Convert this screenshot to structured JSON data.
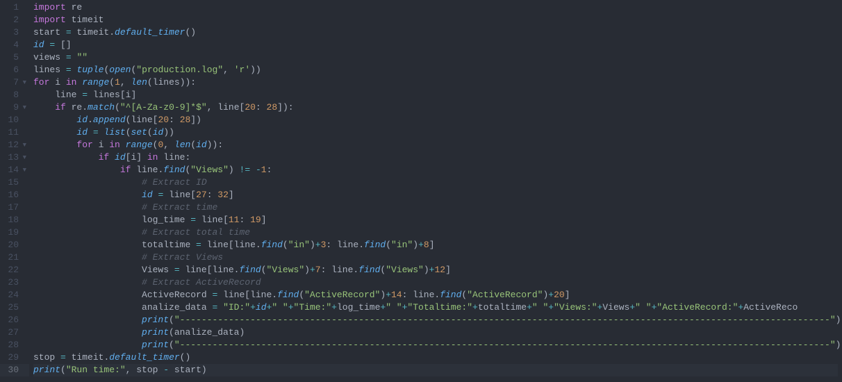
{
  "lines": [
    {
      "num": 1,
      "fold": "",
      "indent": 0,
      "tokens": [
        {
          "t": "import ",
          "c": "kw"
        },
        {
          "t": "re",
          "c": ""
        }
      ]
    },
    {
      "num": 2,
      "fold": "",
      "indent": 0,
      "tokens": [
        {
          "t": "import ",
          "c": "kw"
        },
        {
          "t": "timeit",
          "c": ""
        }
      ]
    },
    {
      "num": 3,
      "fold": "",
      "indent": 0,
      "tokens": [
        {
          "t": "start ",
          "c": ""
        },
        {
          "t": "=",
          "c": "cyan"
        },
        {
          "t": " timeit",
          "c": ""
        },
        {
          "t": ".",
          "c": ""
        },
        {
          "t": "default_timer",
          "c": "italb"
        },
        {
          "t": "()",
          "c": ""
        }
      ]
    },
    {
      "num": 4,
      "fold": "",
      "indent": 0,
      "tokens": [
        {
          "t": "id",
          "c": "italb"
        },
        {
          "t": " ",
          "c": ""
        },
        {
          "t": "=",
          "c": "cyan"
        },
        {
          "t": " []",
          "c": ""
        }
      ]
    },
    {
      "num": 5,
      "fold": "",
      "indent": 0,
      "tokens": [
        {
          "t": "views ",
          "c": ""
        },
        {
          "t": "=",
          "c": "cyan"
        },
        {
          "t": " ",
          "c": ""
        },
        {
          "t": "\"\"",
          "c": "str"
        }
      ]
    },
    {
      "num": 6,
      "fold": "",
      "indent": 0,
      "tokens": [
        {
          "t": "lines ",
          "c": ""
        },
        {
          "t": "=",
          "c": "cyan"
        },
        {
          "t": " ",
          "c": ""
        },
        {
          "t": "tuple",
          "c": "italb"
        },
        {
          "t": "(",
          "c": ""
        },
        {
          "t": "open",
          "c": "italb"
        },
        {
          "t": "(",
          "c": ""
        },
        {
          "t": "\"production.log\"",
          "c": "str"
        },
        {
          "t": ", ",
          "c": ""
        },
        {
          "t": "'r'",
          "c": "str"
        },
        {
          "t": "))",
          "c": ""
        }
      ]
    },
    {
      "num": 7,
      "fold": "▼",
      "indent": 0,
      "tokens": [
        {
          "t": "for ",
          "c": "kw"
        },
        {
          "t": "i ",
          "c": ""
        },
        {
          "t": "in ",
          "c": "kw"
        },
        {
          "t": "range",
          "c": "italb"
        },
        {
          "t": "(",
          "c": ""
        },
        {
          "t": "1",
          "c": "num"
        },
        {
          "t": ", ",
          "c": ""
        },
        {
          "t": "len",
          "c": "italb"
        },
        {
          "t": "(lines)):",
          "c": ""
        }
      ]
    },
    {
      "num": 8,
      "fold": "",
      "indent": 1,
      "tokens": [
        {
          "t": "line ",
          "c": ""
        },
        {
          "t": "=",
          "c": "cyan"
        },
        {
          "t": " lines[i]",
          "c": ""
        }
      ]
    },
    {
      "num": 9,
      "fold": "▼",
      "indent": 1,
      "tokens": [
        {
          "t": "if ",
          "c": "kw"
        },
        {
          "t": "re",
          "c": ""
        },
        {
          "t": ".",
          "c": ""
        },
        {
          "t": "match",
          "c": "italb"
        },
        {
          "t": "(",
          "c": ""
        },
        {
          "t": "\"^[A-Za-z0-9]*$\"",
          "c": "str"
        },
        {
          "t": ", line[",
          "c": ""
        },
        {
          "t": "20",
          "c": "num"
        },
        {
          "t": ": ",
          "c": ""
        },
        {
          "t": "28",
          "c": "num"
        },
        {
          "t": "]):",
          "c": ""
        }
      ]
    },
    {
      "num": 10,
      "fold": "",
      "indent": 2,
      "tokens": [
        {
          "t": "id",
          "c": "italb"
        },
        {
          "t": ".",
          "c": ""
        },
        {
          "t": "append",
          "c": "italb"
        },
        {
          "t": "(line[",
          "c": ""
        },
        {
          "t": "20",
          "c": "num"
        },
        {
          "t": ": ",
          "c": ""
        },
        {
          "t": "28",
          "c": "num"
        },
        {
          "t": "])",
          "c": ""
        }
      ]
    },
    {
      "num": 11,
      "fold": "",
      "indent": 2,
      "tokens": [
        {
          "t": "id",
          "c": "italb"
        },
        {
          "t": " ",
          "c": ""
        },
        {
          "t": "=",
          "c": "cyan"
        },
        {
          "t": " ",
          "c": ""
        },
        {
          "t": "list",
          "c": "italb"
        },
        {
          "t": "(",
          "c": ""
        },
        {
          "t": "set",
          "c": "italb"
        },
        {
          "t": "(",
          "c": ""
        },
        {
          "t": "id",
          "c": "italb"
        },
        {
          "t": "))",
          "c": ""
        }
      ]
    },
    {
      "num": 12,
      "fold": "▼",
      "indent": 2,
      "tokens": [
        {
          "t": "for ",
          "c": "kw"
        },
        {
          "t": "i ",
          "c": ""
        },
        {
          "t": "in ",
          "c": "kw"
        },
        {
          "t": "range",
          "c": "italb"
        },
        {
          "t": "(",
          "c": ""
        },
        {
          "t": "0",
          "c": "num"
        },
        {
          "t": ", ",
          "c": ""
        },
        {
          "t": "len",
          "c": "italb"
        },
        {
          "t": "(",
          "c": ""
        },
        {
          "t": "id",
          "c": "italb"
        },
        {
          "t": ")):",
          "c": ""
        }
      ]
    },
    {
      "num": 13,
      "fold": "▼",
      "indent": 3,
      "tokens": [
        {
          "t": "if ",
          "c": "kw"
        },
        {
          "t": "id",
          "c": "italb"
        },
        {
          "t": "[i] ",
          "c": ""
        },
        {
          "t": "in ",
          "c": "kw"
        },
        {
          "t": "line:",
          "c": ""
        }
      ]
    },
    {
      "num": 14,
      "fold": "▼",
      "indent": 4,
      "tokens": [
        {
          "t": "if ",
          "c": "kw"
        },
        {
          "t": "line",
          "c": ""
        },
        {
          "t": ".",
          "c": ""
        },
        {
          "t": "find",
          "c": "italb"
        },
        {
          "t": "(",
          "c": ""
        },
        {
          "t": "\"Views\"",
          "c": "str"
        },
        {
          "t": ") ",
          "c": ""
        },
        {
          "t": "!=",
          "c": "cyan"
        },
        {
          "t": " ",
          "c": ""
        },
        {
          "t": "-",
          "c": "cyan"
        },
        {
          "t": "1",
          "c": "num"
        },
        {
          "t": ":",
          "c": ""
        }
      ]
    },
    {
      "num": 15,
      "fold": "",
      "indent": 5,
      "tokens": [
        {
          "t": "# Extract ID",
          "c": "com"
        }
      ]
    },
    {
      "num": 16,
      "fold": "",
      "indent": 5,
      "tokens": [
        {
          "t": "id",
          "c": "italb"
        },
        {
          "t": " ",
          "c": ""
        },
        {
          "t": "=",
          "c": "cyan"
        },
        {
          "t": " line[",
          "c": ""
        },
        {
          "t": "27",
          "c": "num"
        },
        {
          "t": ": ",
          "c": ""
        },
        {
          "t": "32",
          "c": "num"
        },
        {
          "t": "]",
          "c": ""
        }
      ]
    },
    {
      "num": 17,
      "fold": "",
      "indent": 5,
      "tokens": [
        {
          "t": "# Extract time",
          "c": "com"
        }
      ]
    },
    {
      "num": 18,
      "fold": "",
      "indent": 5,
      "tokens": [
        {
          "t": "log_time ",
          "c": ""
        },
        {
          "t": "=",
          "c": "cyan"
        },
        {
          "t": " line[",
          "c": ""
        },
        {
          "t": "11",
          "c": "num"
        },
        {
          "t": ": ",
          "c": ""
        },
        {
          "t": "19",
          "c": "num"
        },
        {
          "t": "]",
          "c": ""
        }
      ]
    },
    {
      "num": 19,
      "fold": "",
      "indent": 5,
      "tokens": [
        {
          "t": "# Extract total time",
          "c": "com"
        }
      ]
    },
    {
      "num": 20,
      "fold": "",
      "indent": 5,
      "tokens": [
        {
          "t": "totaltime ",
          "c": ""
        },
        {
          "t": "=",
          "c": "cyan"
        },
        {
          "t": " line[line",
          "c": ""
        },
        {
          "t": ".",
          "c": ""
        },
        {
          "t": "find",
          "c": "italb"
        },
        {
          "t": "(",
          "c": ""
        },
        {
          "t": "\"in\"",
          "c": "str"
        },
        {
          "t": ")",
          "c": ""
        },
        {
          "t": "+",
          "c": "cyan"
        },
        {
          "t": "3",
          "c": "num"
        },
        {
          "t": ": line",
          "c": ""
        },
        {
          "t": ".",
          "c": ""
        },
        {
          "t": "find",
          "c": "italb"
        },
        {
          "t": "(",
          "c": ""
        },
        {
          "t": "\"in\"",
          "c": "str"
        },
        {
          "t": ")",
          "c": ""
        },
        {
          "t": "+",
          "c": "cyan"
        },
        {
          "t": "8",
          "c": "num"
        },
        {
          "t": "]",
          "c": ""
        }
      ]
    },
    {
      "num": 21,
      "fold": "",
      "indent": 5,
      "tokens": [
        {
          "t": "# Extract Views",
          "c": "com"
        }
      ]
    },
    {
      "num": 22,
      "fold": "",
      "indent": 5,
      "tokens": [
        {
          "t": "Views ",
          "c": ""
        },
        {
          "t": "=",
          "c": "cyan"
        },
        {
          "t": " line[line",
          "c": ""
        },
        {
          "t": ".",
          "c": ""
        },
        {
          "t": "find",
          "c": "italb"
        },
        {
          "t": "(",
          "c": ""
        },
        {
          "t": "\"Views\"",
          "c": "str"
        },
        {
          "t": ")",
          "c": ""
        },
        {
          "t": "+",
          "c": "cyan"
        },
        {
          "t": "7",
          "c": "num"
        },
        {
          "t": ": line",
          "c": ""
        },
        {
          "t": ".",
          "c": ""
        },
        {
          "t": "find",
          "c": "italb"
        },
        {
          "t": "(",
          "c": ""
        },
        {
          "t": "\"Views\"",
          "c": "str"
        },
        {
          "t": ")",
          "c": ""
        },
        {
          "t": "+",
          "c": "cyan"
        },
        {
          "t": "12",
          "c": "num"
        },
        {
          "t": "]",
          "c": ""
        }
      ]
    },
    {
      "num": 23,
      "fold": "",
      "indent": 5,
      "tokens": [
        {
          "t": "# Extract ActiveRecord",
          "c": "com"
        }
      ]
    },
    {
      "num": 24,
      "fold": "",
      "indent": 5,
      "tokens": [
        {
          "t": "ActiveRecord ",
          "c": ""
        },
        {
          "t": "=",
          "c": "cyan"
        },
        {
          "t": " line[line",
          "c": ""
        },
        {
          "t": ".",
          "c": ""
        },
        {
          "t": "find",
          "c": "italb"
        },
        {
          "t": "(",
          "c": ""
        },
        {
          "t": "\"ActiveRecord\"",
          "c": "str"
        },
        {
          "t": ")",
          "c": ""
        },
        {
          "t": "+",
          "c": "cyan"
        },
        {
          "t": "14",
          "c": "num"
        },
        {
          "t": ": line",
          "c": ""
        },
        {
          "t": ".",
          "c": ""
        },
        {
          "t": "find",
          "c": "italb"
        },
        {
          "t": "(",
          "c": ""
        },
        {
          "t": "\"ActiveRecord\"",
          "c": "str"
        },
        {
          "t": ")",
          "c": ""
        },
        {
          "t": "+",
          "c": "cyan"
        },
        {
          "t": "20",
          "c": "num"
        },
        {
          "t": "]",
          "c": ""
        }
      ]
    },
    {
      "num": 25,
      "fold": "",
      "indent": 5,
      "tokens": [
        {
          "t": "analize_data ",
          "c": ""
        },
        {
          "t": "=",
          "c": "cyan"
        },
        {
          "t": " ",
          "c": ""
        },
        {
          "t": "\"ID:\"",
          "c": "str"
        },
        {
          "t": "+",
          "c": "cyan"
        },
        {
          "t": "id",
          "c": "italb"
        },
        {
          "t": "+",
          "c": "cyan"
        },
        {
          "t": "\" \"",
          "c": "str"
        },
        {
          "t": "+",
          "c": "cyan"
        },
        {
          "t": "\"Time:\"",
          "c": "str"
        },
        {
          "t": "+",
          "c": "cyan"
        },
        {
          "t": "log_time",
          "c": ""
        },
        {
          "t": "+",
          "c": "cyan"
        },
        {
          "t": "\" \"",
          "c": "str"
        },
        {
          "t": "+",
          "c": "cyan"
        },
        {
          "t": "\"Totaltime:\"",
          "c": "str"
        },
        {
          "t": "+",
          "c": "cyan"
        },
        {
          "t": "totaltime",
          "c": ""
        },
        {
          "t": "+",
          "c": "cyan"
        },
        {
          "t": "\" \"",
          "c": "str"
        },
        {
          "t": "+",
          "c": "cyan"
        },
        {
          "t": "\"Views:\"",
          "c": "str"
        },
        {
          "t": "+",
          "c": "cyan"
        },
        {
          "t": "Views",
          "c": ""
        },
        {
          "t": "+",
          "c": "cyan"
        },
        {
          "t": "\" \"",
          "c": "str"
        },
        {
          "t": "+",
          "c": "cyan"
        },
        {
          "t": "\"ActiveRecord:\"",
          "c": "str"
        },
        {
          "t": "+",
          "c": "cyan"
        },
        {
          "t": "ActiveReco",
          "c": ""
        }
      ]
    },
    {
      "num": 26,
      "fold": "",
      "indent": 5,
      "tokens": [
        {
          "t": "print",
          "c": "italb"
        },
        {
          "t": "(",
          "c": ""
        },
        {
          "t": "\"------------------------------------------------------------------------------------------------------------------------\"",
          "c": "str"
        },
        {
          "t": ")",
          "c": ""
        }
      ]
    },
    {
      "num": 27,
      "fold": "",
      "indent": 5,
      "tokens": [
        {
          "t": "print",
          "c": "italb"
        },
        {
          "t": "(analize_data)",
          "c": ""
        }
      ]
    },
    {
      "num": 28,
      "fold": "",
      "indent": 5,
      "tokens": [
        {
          "t": "print",
          "c": "italb"
        },
        {
          "t": "(",
          "c": ""
        },
        {
          "t": "\"------------------------------------------------------------------------------------------------------------------------\"",
          "c": "str"
        },
        {
          "t": ")",
          "c": ""
        }
      ]
    },
    {
      "num": 29,
      "fold": "",
      "indent": 0,
      "tokens": [
        {
          "t": "stop ",
          "c": ""
        },
        {
          "t": "=",
          "c": "cyan"
        },
        {
          "t": " timeit",
          "c": ""
        },
        {
          "t": ".",
          "c": ""
        },
        {
          "t": "default_timer",
          "c": "italb"
        },
        {
          "t": "()",
          "c": ""
        }
      ]
    },
    {
      "num": 30,
      "fold": "",
      "indent": 0,
      "active": true,
      "tokens": [
        {
          "t": "print",
          "c": "italb"
        },
        {
          "t": "(",
          "c": ""
        },
        {
          "t": "\"Run time:\"",
          "c": "str"
        },
        {
          "t": ", stop ",
          "c": ""
        },
        {
          "t": "-",
          "c": "cyan"
        },
        {
          "t": " start)",
          "c": ""
        }
      ]
    }
  ],
  "indent_unit": "    "
}
